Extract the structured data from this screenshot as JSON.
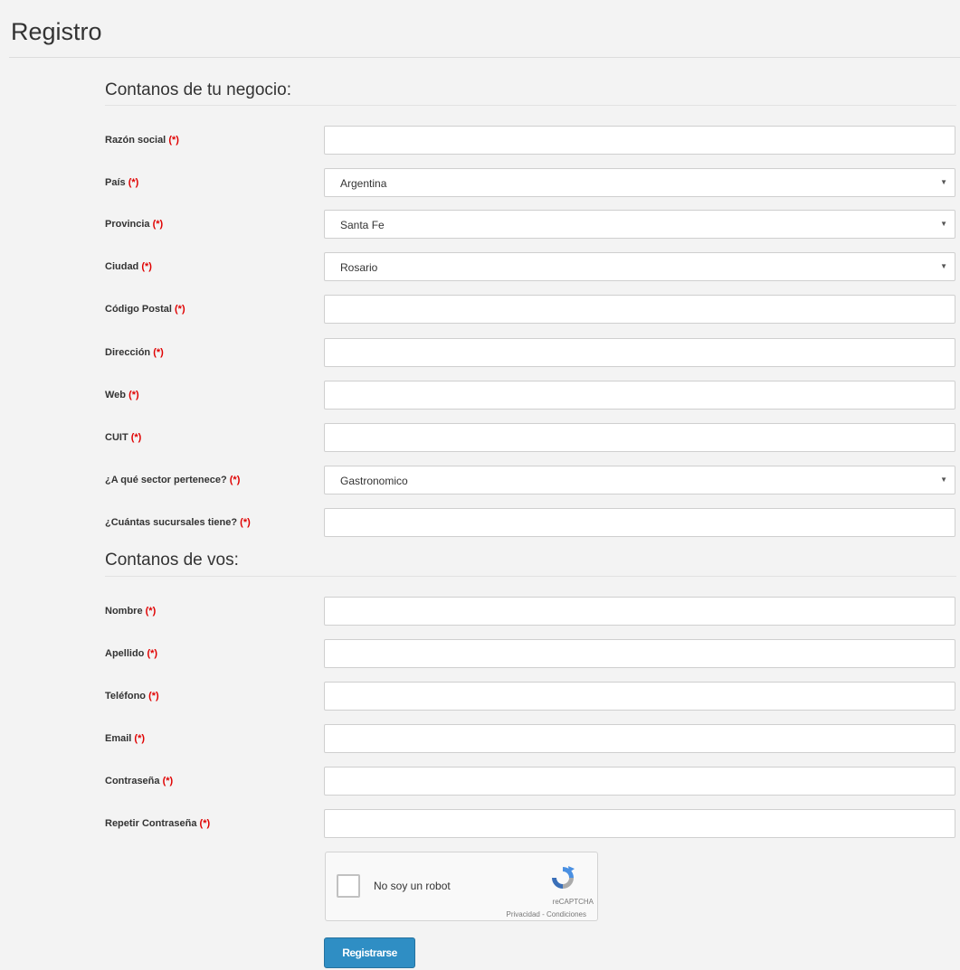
{
  "page": {
    "title": "Registro"
  },
  "business": {
    "heading": "Contanos de tu negocio:",
    "fields": [
      {
        "label": "Razón social",
        "required": "(*)",
        "type": "text",
        "value": ""
      },
      {
        "label": "País",
        "required": "(*)",
        "type": "select",
        "value": "Argentina"
      },
      {
        "label": "Provincia",
        "required": "(*)",
        "type": "select",
        "value": "Santa Fe"
      },
      {
        "label": "Ciudad",
        "required": "(*)",
        "type": "select",
        "value": "Rosario"
      },
      {
        "label": "Código Postal",
        "required": "(*)",
        "type": "text",
        "value": ""
      },
      {
        "label": "Dirección",
        "required": "(*)",
        "type": "text",
        "value": ""
      },
      {
        "label": "Web",
        "required": "(*)",
        "type": "text",
        "value": ""
      },
      {
        "label": "CUIT",
        "required": "(*)",
        "type": "text",
        "value": ""
      },
      {
        "label": "¿A qué sector pertenece?",
        "required": "(*)",
        "type": "select",
        "value": "Gastronomico"
      },
      {
        "label": "¿Cuántas sucursales tiene?",
        "required": "(*)",
        "type": "text",
        "value": ""
      }
    ]
  },
  "personal": {
    "heading": "Contanos de vos:",
    "fields": [
      {
        "label": "Nombre",
        "required": "(*)",
        "type": "text",
        "value": ""
      },
      {
        "label": "Apellido",
        "required": "(*)",
        "type": "text",
        "value": ""
      },
      {
        "label": "Teléfono",
        "required": "(*)",
        "type": "text",
        "value": ""
      },
      {
        "label": "Email",
        "required": "(*)",
        "type": "text",
        "value": ""
      },
      {
        "label": "Contraseña",
        "required": "(*)",
        "type": "password",
        "value": ""
      },
      {
        "label": "Repetir Contraseña",
        "required": "(*)",
        "type": "password",
        "value": ""
      }
    ]
  },
  "captcha": {
    "label": "No soy un robot",
    "brand": "reCAPTCHA",
    "links": "Privacidad - Condiciones",
    "icon": "recaptcha-logo-icon"
  },
  "submit": {
    "label": "Registrarse",
    "color": "#2f8ec4"
  },
  "colors": {
    "required": "#e00000",
    "background": "#f3f3f3"
  }
}
